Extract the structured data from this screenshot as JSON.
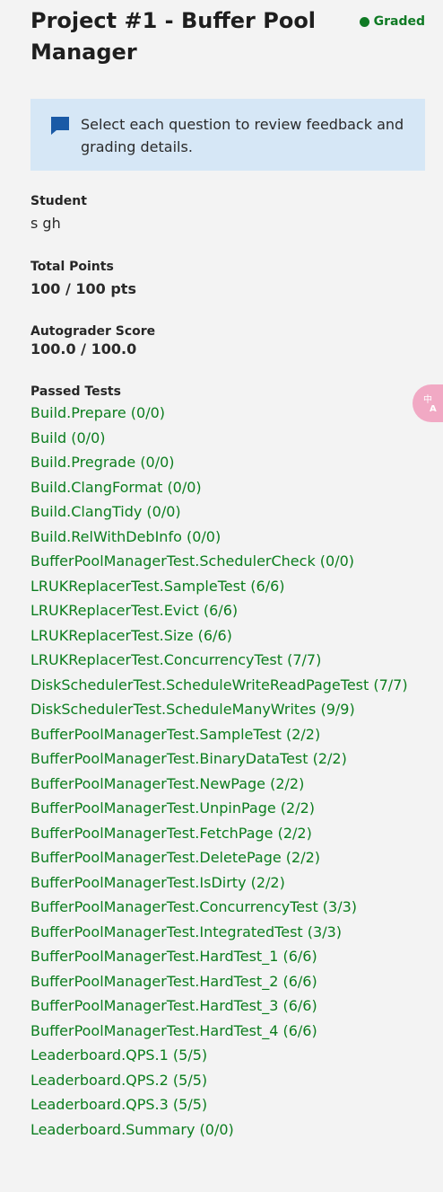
{
  "header": {
    "title": "Project #1 - Buffer Pool Manager",
    "status": "Graded",
    "status_color": "#0f7a24"
  },
  "info": {
    "icon": "comment-icon",
    "text": "Select each question to review feedback and grading details."
  },
  "student": {
    "label": "Student",
    "value": "s gh"
  },
  "total_points": {
    "label": "Total Points",
    "value": "100 / 100 pts"
  },
  "autograder": {
    "label": "Autograder Score",
    "value": "100.0 / 100.0"
  },
  "tests": {
    "label": "Passed Tests",
    "link_color": "#0b7d1e",
    "items": [
      "Build.Prepare (0/0)",
      "Build (0/0)",
      "Build.Pregrade (0/0)",
      "Build.ClangFormat (0/0)",
      "Build.ClangTidy (0/0)",
      "Build.RelWithDebInfo (0/0)",
      "BufferPoolManagerTest.SchedulerCheck (0/0)",
      "LRUKReplacerTest.SampleTest (6/6)",
      "LRUKReplacerTest.Evict (6/6)",
      "LRUKReplacerTest.Size (6/6)",
      "LRUKReplacerTest.ConcurrencyTest (7/7)",
      "DiskSchedulerTest.ScheduleWriteReadPageTest (7/7)",
      "DiskSchedulerTest.ScheduleManyWrites (9/9)",
      "BufferPoolManagerTest.SampleTest (2/2)",
      "BufferPoolManagerTest.BinaryDataTest (2/2)",
      "BufferPoolManagerTest.NewPage (2/2)",
      "BufferPoolManagerTest.UnpinPage (2/2)",
      "BufferPoolManagerTest.FetchPage (2/2)",
      "BufferPoolManagerTest.DeletePage (2/2)",
      "BufferPoolManagerTest.IsDirty (2/2)",
      "BufferPoolManagerTest.ConcurrencyTest (3/3)",
      "BufferPoolManagerTest.IntegratedTest (3/3)",
      "BufferPoolManagerTest.HardTest_1 (6/6)",
      "BufferPoolManagerTest.HardTest_2 (6/6)",
      "BufferPoolManagerTest.HardTest_3 (6/6)",
      "BufferPoolManagerTest.HardTest_4 (6/6)",
      "Leaderboard.QPS.1 (5/5)",
      "Leaderboard.QPS.2 (5/5)",
      "Leaderboard.QPS.3 (5/5)",
      "Leaderboard.Summary (0/0)"
    ]
  },
  "overlay": {
    "icon": "translate-icon"
  }
}
